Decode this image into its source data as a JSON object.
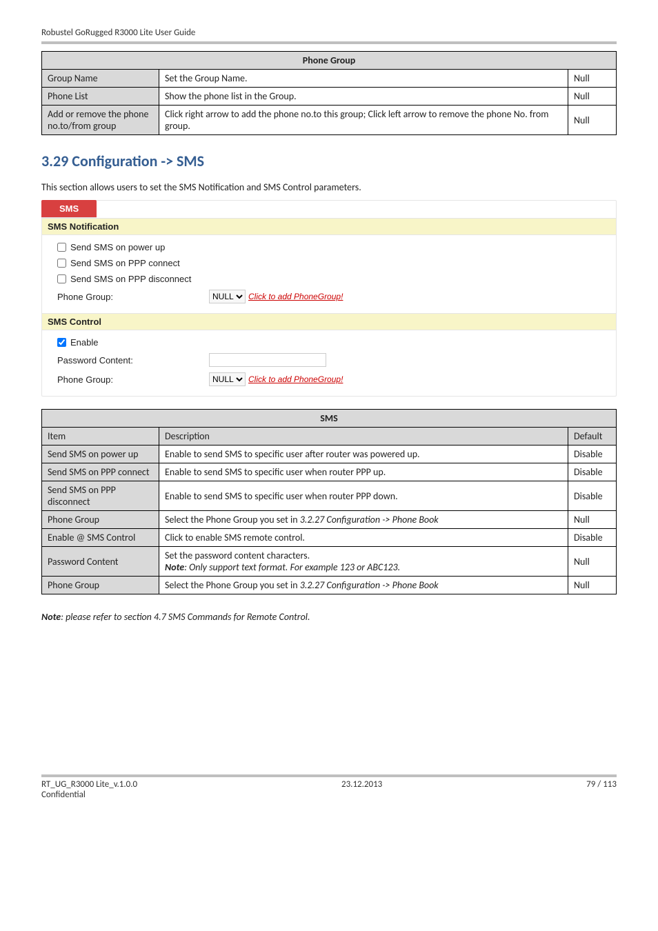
{
  "header": {
    "text": "Robustel GoRugged R3000 Lite User Guide"
  },
  "table_phone_group": {
    "title": "Phone Group",
    "rows": [
      {
        "label": "Group Name",
        "desc": "Set the Group Name.",
        "def": "Null"
      },
      {
        "label": "Phone List",
        "desc": "Show the phone list in the Group.",
        "def": "Null"
      },
      {
        "label": "Add or remove the phone no.to/from group",
        "desc": "Click right arrow to add the phone no.to this group; Click left arrow to remove the phone No. from group.",
        "def": "Null"
      }
    ]
  },
  "section": {
    "title": "3.29  Configuration -> SMS",
    "intro": "This section allows users to set the SMS Notification and SMS Control parameters."
  },
  "panel": {
    "tab": "SMS",
    "notif_title": "SMS Notification",
    "cb_power": "Send SMS on power up",
    "cb_ppp_con": "Send SMS on PPP connect",
    "cb_ppp_dis": "Send SMS on PPP disconnect",
    "phone_group_lbl": "Phone Group:",
    "phone_group_opt": "NULL",
    "phone_group_link": "Click to add PhoneGroup!",
    "ctrl_title": "SMS Control",
    "enable_lbl": "Enable",
    "pw_lbl": "Password Content:"
  },
  "table_sms": {
    "title": "SMS",
    "head_item": "Item",
    "head_desc": "Description",
    "head_def": "Default",
    "rows": [
      {
        "label": "Send SMS on power up",
        "desc": "Enable to send SMS to specific user after router was powered up.",
        "def": "Disable"
      },
      {
        "label": "Send SMS on PPP connect",
        "desc": "Enable to send SMS to specific user when router PPP up.",
        "def": "Disable"
      },
      {
        "label": "Send SMS on PPP disconnect",
        "desc": "Enable to send SMS to specific user when router PPP down.",
        "def": "Disable"
      },
      {
        "label": "Phone Group",
        "desc_pre": "Select the Phone Group you set in ",
        "desc_it": "3.2.27 Configuration -> Phone Book",
        "def": "Null"
      },
      {
        "label": "Enable @ SMS Control",
        "desc": "Click to enable SMS remote control.",
        "def": "Disable"
      },
      {
        "label": "Password Content",
        "desc_l1": "Set the password content characters.",
        "desc_note_bold": "Note",
        "desc_note_rest": ": Only support text format. For example 123 or ABC123.",
        "def": "Null"
      },
      {
        "label": "Phone Group",
        "desc_pre": "Select the Phone Group you set in ",
        "desc_it": "3.2.27 Configuration -> Phone Book",
        "def": "Null"
      }
    ]
  },
  "note": {
    "bold": "Note",
    "rest": ": please refer to section 4.7 SMS Commands for Remote Control."
  },
  "footer": {
    "left_l1": "RT_UG_R3000 Lite_v.1.0.0",
    "left_l2": "Confidential",
    "center": "23.12.2013",
    "right": "79 / 113"
  }
}
